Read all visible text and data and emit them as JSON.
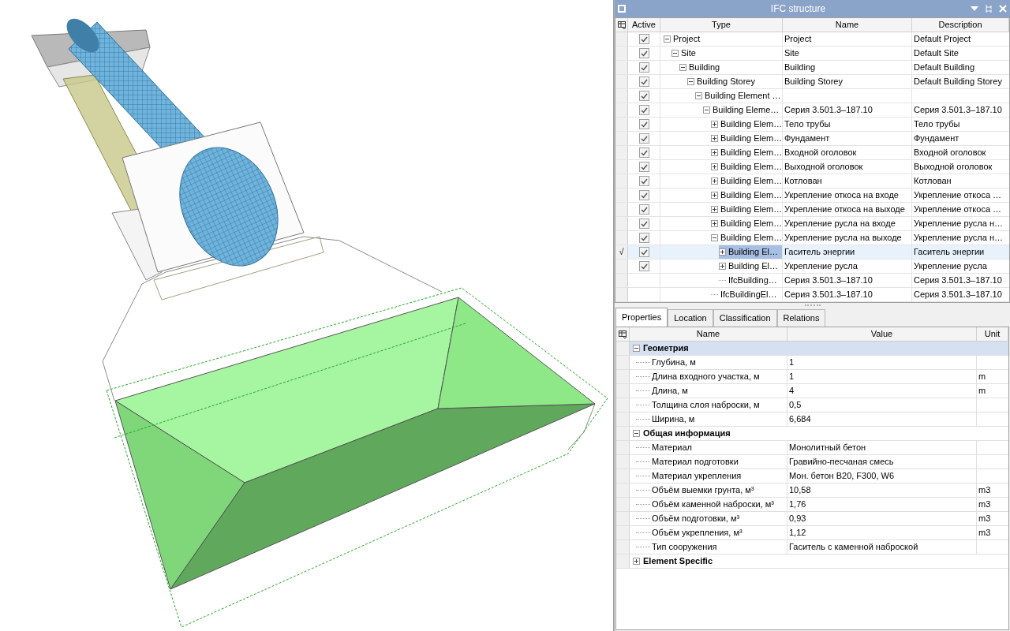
{
  "ifc_structure": {
    "title": "IFC structure",
    "columns": [
      "Active",
      "Type",
      "Name",
      "Description"
    ],
    "tree": [
      {
        "kind": "node",
        "type": "Project",
        "name": "Project",
        "description": "Default Project",
        "active": true,
        "expanded": true,
        "selected": false,
        "children": [
          {
            "kind": "node",
            "type": "Site",
            "name": "Site",
            "description": "Default Site",
            "active": true,
            "expanded": true,
            "selected": false,
            "children": [
              {
                "kind": "node",
                "type": "Building",
                "name": "Building",
                "description": "Default Building",
                "active": true,
                "expanded": true,
                "selected": false,
                "children": [
                  {
                    "kind": "node",
                    "type": "Building Storey",
                    "name": "Building Storey",
                    "description": "Default Building Storey",
                    "active": true,
                    "expanded": true,
                    "selected": false,
                    "children": [
                      {
                        "kind": "node",
                        "type": "Building Element …",
                        "active": true,
                        "expanded": true,
                        "selected": false,
                        "children": [
                          {
                            "kind": "node",
                            "type": "Building Eleme…",
                            "name": "Серия 3.501.3–187.10",
                            "description": "Серия 3.501.3–187.10",
                            "active": true,
                            "expanded": true,
                            "selected": false,
                            "children": [
                              {
                                "kind": "node",
                                "type": "Building Elem…",
                                "name": "Тело трубы",
                                "description": "Тело трубы",
                                "active": true,
                                "expanded": false,
                                "selected": false
                              },
                              {
                                "kind": "node",
                                "type": "Building Elem…",
                                "name": "Фундамент",
                                "description": "Фундамент",
                                "active": true,
                                "expanded": false,
                                "selected": false
                              },
                              {
                                "kind": "node",
                                "type": "Building Elem…",
                                "name": "Входной оголовок",
                                "description": "Входной оголовок",
                                "active": true,
                                "expanded": false,
                                "selected": false
                              },
                              {
                                "kind": "node",
                                "type": "Building Elem…",
                                "name": "Выходной оголовок",
                                "description": "Выходной оголовок",
                                "active": true,
                                "expanded": false,
                                "selected": false
                              },
                              {
                                "kind": "node",
                                "type": "Building Elem…",
                                "name": "Котлован",
                                "description": "Котлован",
                                "active": true,
                                "expanded": false,
                                "selected": false
                              },
                              {
                                "kind": "node",
                                "type": "Building Elem…",
                                "name": "Укрепление откоса на входе",
                                "description": "Укрепление откоса …",
                                "active": true,
                                "expanded": false,
                                "selected": false
                              },
                              {
                                "kind": "node",
                                "type": "Building Elem…",
                                "name": "Укрепление откоса на выходе",
                                "description": "Укрепление откоса …",
                                "active": true,
                                "expanded": false,
                                "selected": false
                              },
                              {
                                "kind": "node",
                                "type": "Building Elem…",
                                "name": "Укрепление русла на входе",
                                "description": "Укрепление русла н…",
                                "active": true,
                                "expanded": false,
                                "selected": false
                              },
                              {
                                "kind": "node",
                                "type": "Building Elem…",
                                "name": "Укрепление русла на выходе",
                                "description": "Укрепление русла н…",
                                "active": true,
                                "expanded": true,
                                "selected": false,
                                "children": [
                                  {
                                    "kind": "node",
                                    "type": "Building El…",
                                    "name": "Гаситель энергии",
                                    "description": "Гаситель энергии",
                                    "active": true,
                                    "expanded": false,
                                    "selected": true,
                                    "row_marker": "√"
                                  },
                                  {
                                    "kind": "node",
                                    "type": "Building El…",
                                    "name": "Укрепление русла",
                                    "description": "Укрепление русла",
                                    "active": true,
                                    "expanded": false,
                                    "selected": false
                                  },
                                  {
                                    "kind": "leaf",
                                    "type": "IfcBuilding…",
                                    "name": "Серия 3.501.3–187.10",
                                    "description": "Серия 3.501.3–187.10",
                                    "selected": false
                                  }
                                ]
                              },
                              {
                                "kind": "leaf",
                                "type": "IfcBuildingEl…",
                                "name": "Серия 3.501.3–187.10",
                                "description": "Серия 3.501.3–187.10",
                                "selected": false
                              }
                            ]
                          }
                        ]
                      }
                    ]
                  }
                ]
              }
            ]
          }
        ]
      }
    ]
  },
  "tabs": [
    {
      "label": "Properties",
      "selected": true
    },
    {
      "label": "Location",
      "selected": false
    },
    {
      "label": "Classification",
      "selected": false
    },
    {
      "label": "Relations",
      "selected": false
    }
  ],
  "properties": {
    "columns": [
      "Name",
      "Value",
      "Unit"
    ],
    "groups": [
      {
        "title": "Геометрия",
        "expanded": true,
        "selected": true,
        "rows": [
          {
            "name": "Глубина, м",
            "value": "1",
            "unit": ""
          },
          {
            "name": "Длина входного участка, м",
            "value": "1",
            "unit": "m"
          },
          {
            "name": "Длина, м",
            "value": "4",
            "unit": "m"
          },
          {
            "name": "Толщина слоя наброски, м",
            "value": "0,5",
            "unit": ""
          },
          {
            "name": "Ширина, м",
            "value": "6,684",
            "unit": ""
          }
        ]
      },
      {
        "title": "Общая информация",
        "expanded": true,
        "selected": false,
        "rows": [
          {
            "name": "Материал",
            "value": "Монолитный бетон",
            "unit": ""
          },
          {
            "name": "Материал подготовки",
            "value": "Гравийно-песчаная смесь",
            "unit": ""
          },
          {
            "name": "Материал укрепления",
            "value": "Мон. бетон B20, F300, W6",
            "unit": ""
          },
          {
            "name": "Объём выемки грунта, м³",
            "value": "10,58",
            "unit": "m3"
          },
          {
            "name": "Объём каменной наброски, м³",
            "value": "1,76",
            "unit": "m3"
          },
          {
            "name": "Объём подготовки, м³",
            "value": "0,93",
            "unit": "m3"
          },
          {
            "name": "Объём укрепления, м³",
            "value": "1,12",
            "unit": "m3"
          },
          {
            "name": "Тип сооружения",
            "value": "Гаситель с каменной наброской",
            "unit": ""
          }
        ]
      },
      {
        "title": "Element Specific",
        "expanded": false,
        "selected": false
      }
    ]
  }
}
